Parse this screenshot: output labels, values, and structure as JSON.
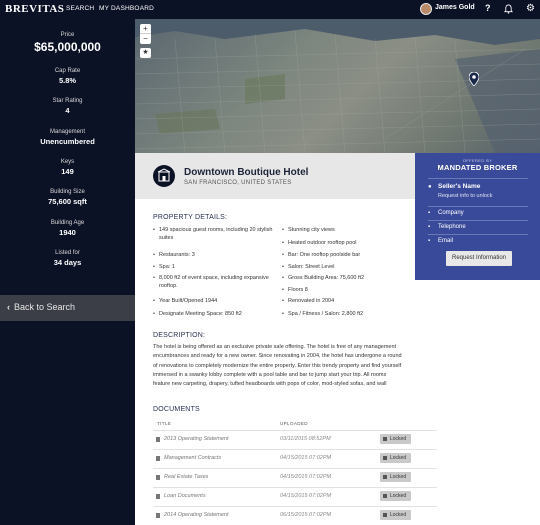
{
  "topbar": {
    "logo": "BREVITAS",
    "nav": [
      "SEARCH",
      "MY DASHBOARD"
    ],
    "user_name": "James Gold",
    "help_icon": "?",
    "icons": [
      "user-avatar",
      "help-icon",
      "bell-icon",
      "gear-icon"
    ]
  },
  "sidebar": {
    "stats": [
      {
        "label": "Price",
        "value": "$65,000,000"
      },
      {
        "label": "Cap Rate",
        "value": "5.8%"
      },
      {
        "label": "Star Rating",
        "value": "4"
      },
      {
        "label": "Management",
        "value": "Unencumbered"
      },
      {
        "label": "Keys",
        "value": "149"
      },
      {
        "label": "Building Size",
        "value": "75,600 sqft"
      },
      {
        "label": "Building Age",
        "value": "1940"
      },
      {
        "label": "Listed for",
        "value": "34 days"
      }
    ],
    "back_label": "Back to Search"
  },
  "map": {
    "zoom_in": "+",
    "zoom_out": "−",
    "star": "★"
  },
  "listing": {
    "name": "Downtown Boutique Hotel",
    "location": "SAN FRANCISCO, UNITED STATES"
  },
  "broker": {
    "offered_by": "OFFERED BY",
    "name": "MANDATED BROKER",
    "seller_label": "Seller's Name",
    "seller_sub": "Request info to unlock",
    "fields": [
      "Company",
      "Telephone",
      "Email"
    ],
    "request_button": "Request Information"
  },
  "details": {
    "title": "PROPERTY DETAILS:",
    "left": [
      "149 spacious guest rooms, including 20 stylish suites",
      "Restaurants: 3",
      "Spa: 1",
      "8,000 ft2 of event space, including expansive rooftop.",
      "Year Built/Opened 1944",
      "Designate Meeting Space: 850 ft2"
    ],
    "right": [
      "Stunning city views",
      "Heated outdoor rooftop pool",
      "Bar: One rooftop poolside bar",
      "Salon: Street Level",
      "Gross Building Area: 75,600 ft2",
      "Floors 8",
      "Renovated in 2004",
      "Spa / Fitness / Salon: 2,800 ft2"
    ]
  },
  "description": {
    "title": "DESCRIPTION:",
    "text": "The hotel is being offered as an exclusive private sale offering. The hotel is free of any management encumbrances and ready for a new owner. Since renovating in 2004, the hotel has undergone a round of renovations to completely modernize the entire property. Enter this trendy property and find yourself immersed in a swanky lobby complete with a pool table and bar to jump start your trip. All rooms feature new carpeting, drapery, tufted headboards with pops of color, mod-styled sofas, and wall"
  },
  "documents": {
    "title": "DOCUMENTS",
    "col_title": "TITLE",
    "col_uploaded": "UPLOADED",
    "rows": [
      {
        "title": "2013 Operating Statement",
        "uploaded": "03/11/2015 08:52PM",
        "status": "Locked"
      },
      {
        "title": "Management Contracts",
        "uploaded": "04/15/2015 07:02PM",
        "status": "Locked"
      },
      {
        "title": "Real Estate Taxes",
        "uploaded": "04/15/2015 07:02PM",
        "status": "Locked"
      },
      {
        "title": "Loan Documents",
        "uploaded": "04/15/2015 07:02PM",
        "status": "Locked"
      },
      {
        "title": "2014 Operating Statement",
        "uploaded": "06/15/2015 07:02PM",
        "status": "Locked"
      }
    ]
  },
  "colors": {
    "navy": "#0c1226",
    "broker_blue": "#3a4a9a",
    "back_gray": "#3b3e46"
  }
}
